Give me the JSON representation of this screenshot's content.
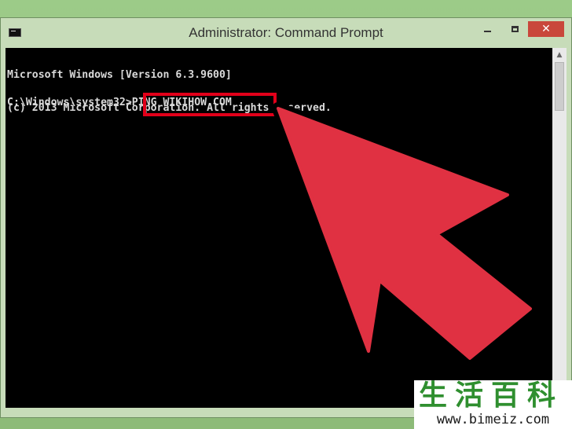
{
  "window": {
    "title": "Administrator: Command Prompt",
    "icon": "command-prompt-icon",
    "buttons": {
      "close_glyph": "✕"
    }
  },
  "console": {
    "lines": [
      "Microsoft Windows [Version 6.3.9600]",
      "(c) 2013 Microsoft Corporation. All rights reserved."
    ],
    "prompt": "C:\\Windows\\system32>",
    "command": "PING WIKIHOW.COM"
  },
  "annotation": {
    "highlight_color": "#e2001a",
    "arrow_color": "#e03142"
  },
  "watermark": {
    "chars": "生活百科",
    "url": "www.bimeiz.com"
  }
}
